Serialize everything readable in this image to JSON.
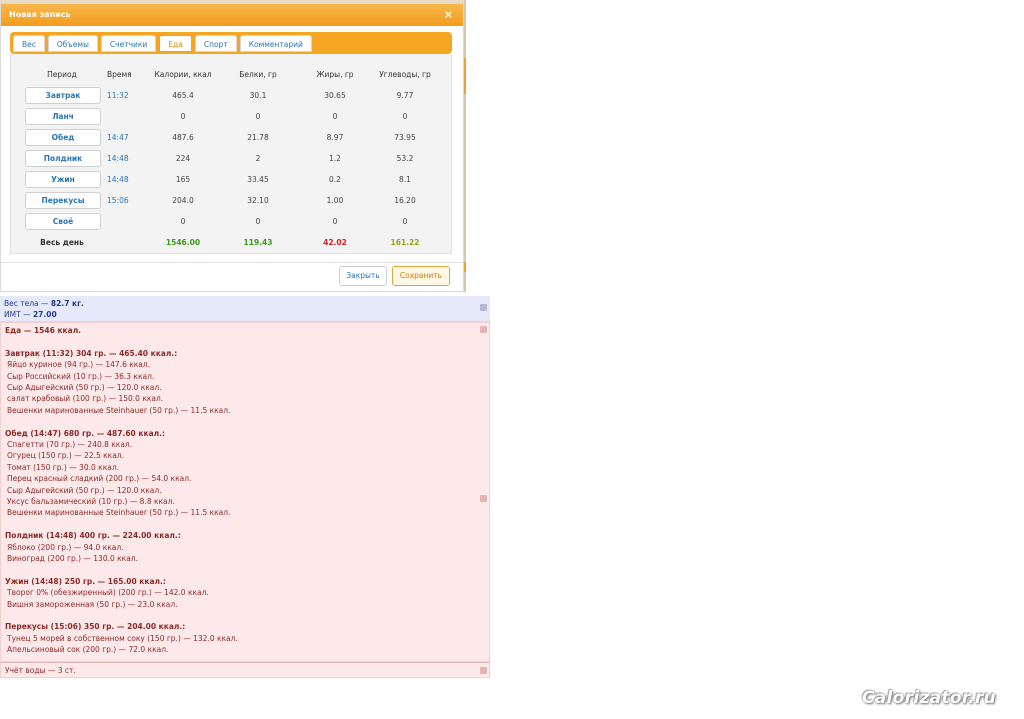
{
  "dialog": {
    "title": "Новая запись",
    "close_glyph": "×",
    "tabs": [
      {
        "label": "Вес",
        "active": false
      },
      {
        "label": "Объемы",
        "active": false
      },
      {
        "label": "Счетчики",
        "active": false
      },
      {
        "label": "Еда",
        "active": true
      },
      {
        "label": "Спорт",
        "active": false
      },
      {
        "label": "Комментарий",
        "active": false
      }
    ],
    "table": {
      "headers": {
        "period": "Период",
        "time": "Время",
        "kcal": "Калории, ккал",
        "protein": "Белки, гр",
        "fat": "Жиры, гр",
        "carbs": "Углеводы, гр"
      },
      "rows": [
        {
          "period": "Завтрак",
          "time": "11:32",
          "kcal": "465.4",
          "protein": "30.1",
          "fat": "30.65",
          "carbs": "9.77"
        },
        {
          "period": "Ланч",
          "time": "",
          "kcal": "0",
          "protein": "0",
          "fat": "0",
          "carbs": "0"
        },
        {
          "period": "Обед",
          "time": "14:47",
          "kcal": "487.6",
          "protein": "21.78",
          "fat": "8.97",
          "carbs": "73.95"
        },
        {
          "period": "Полдник",
          "time": "14:48",
          "kcal": "224",
          "protein": "2",
          "fat": "1.2",
          "carbs": "53.2"
        },
        {
          "period": "Ужин",
          "time": "14:48",
          "kcal": "165",
          "protein": "33.45",
          "fat": "0.2",
          "carbs": "8.1"
        },
        {
          "period": "Перекусы",
          "time": "15:06",
          "kcal": "204.0",
          "protein": "32.10",
          "fat": "1.00",
          "carbs": "16.20"
        },
        {
          "period": "Своё",
          "time": "",
          "kcal": "0",
          "protein": "0",
          "fat": "0",
          "carbs": "0"
        }
      ],
      "total": {
        "label": "Весь день",
        "kcal": "1546.00",
        "protein": "119.43",
        "fat": "42.02",
        "carbs": "161.22"
      }
    },
    "buttons": {
      "close": "Закрыть",
      "save": "Сохранить"
    }
  },
  "journal": {
    "weight_label": "Вес тела — ",
    "weight_value": "82.7 кг.",
    "bmi_label": "ИМТ — ",
    "bmi_value": "27.00",
    "food_total": "Еда — 1546 ккал.",
    "meals": [
      {
        "header": "Завтрак (11:32) 304 гр. — 465.40 ккал.:",
        "items": [
          "Яйцо куриное (94 гр.) — 147.6 ккал.",
          "Сыр Российский (10 гр.) — 36.3 ккал.",
          "Сыр Адыгейский (50 гр.) — 120.0 ккал.",
          "салат крабовый (100 гр.) — 150.0 ккал.",
          "Вешенки маринованные Steinhauer (50 гр.) — 11.5 ккал."
        ]
      },
      {
        "header": "Обед (14:47) 680 гр. — 487.60 ккал.:",
        "items": [
          "Спагетти (70 гр.) — 240.8 ккал.",
          "Огурец (150 гр.) — 22.5 ккал.",
          "Томат (150 гр.) — 30.0 ккал.",
          "Перец красный сладкий (200 гр.) — 54.0 ккал.",
          "Сыр Адыгейский (50 гр.) — 120.0 ккал.",
          "Уксус бальзамический (10 гр.) — 8.8 ккал.",
          "Вешенки маринованные Steinhauer (50 гр.) — 11.5 ккал."
        ]
      },
      {
        "header": "Полдник (14:48) 400 гр. — 224.00 ккал.:",
        "items": [
          "Яблоко (200 гр.) — 94.0 ккал.",
          "Виноград (200 гр.) — 130.0 ккал."
        ]
      },
      {
        "header": "Ужин (14:48) 250 гр. — 165.00 ккал.:",
        "items": [
          "Творог 0% (обезжиренный) (200 гр.) — 142.0 ккал.",
          "Вишня замороженная (50 гр.) — 23.0 ккал."
        ]
      },
      {
        "header": "Перекусы (15:06) 350 гр. — 204.00 ккал.:",
        "items": [
          "Тунец 5 морей в собственном соку (150 гр.) — 132.0 ккал.",
          "Апельсиновый сок (200 гр.) — 72.0 ккал."
        ]
      }
    ],
    "water": "Учёт воды — 3 ст."
  },
  "watermark": "Calorizator.ru",
  "colors": {
    "accent_orange": "#f5a623",
    "link_blue": "#2a76b6",
    "green": "#3a9a1a",
    "red": "#d42020",
    "olive": "#9aa21a"
  }
}
